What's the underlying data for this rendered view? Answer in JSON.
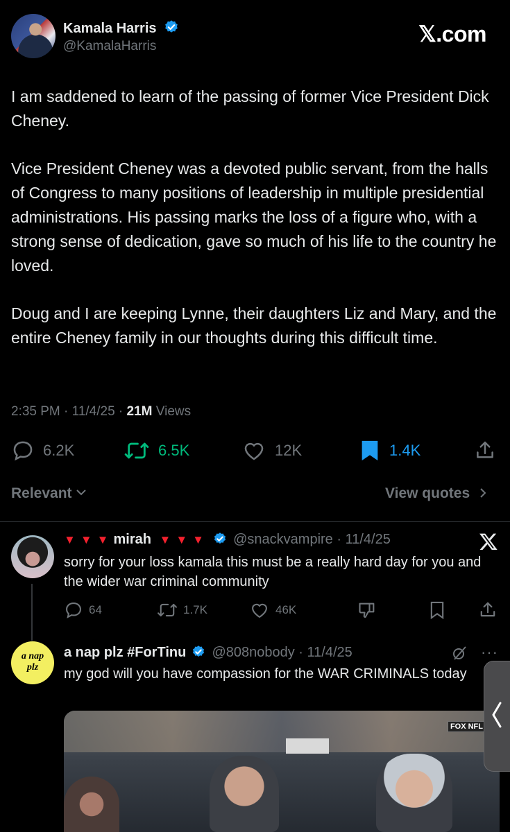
{
  "post": {
    "author_name": "Kamala Harris",
    "handle": "@KamalaHarris",
    "watermark": "𝕏.com",
    "paragraphs": [
      "I am saddened to learn of the passing of former Vice President Dick Cheney.",
      "Vice President Cheney was a devoted public servant, from the halls of Congress to many positions of leadership in multiple presidential administrations. His passing marks the loss of a figure who, with a strong sense of dedication, gave so much of his life to the country he loved.",
      "Doug and I are keeping Lynne, their daughters Liz and Mary, and the entire Cheney family in our thoughts during this difficult time."
    ],
    "time": "2:35 PM",
    "date": "11/4/25",
    "views_count": "21M",
    "views_label": "Views",
    "stats": {
      "replies": "6.2K",
      "reposts": "6.5K",
      "likes": "12K",
      "bookmarks": "1.4K"
    }
  },
  "filters": {
    "sort_label": "Relevant",
    "quotes_label": "View quotes"
  },
  "replies": [
    {
      "name": "mirah",
      "handle": "@snackvampire",
      "date": "11/4/25",
      "text": "sorry for your loss kamala this must be a really hard day for you and the wider war criminal community",
      "stats": {
        "replies": "64",
        "reposts": "1.7K",
        "likes": "46K"
      }
    },
    {
      "name": "a nap plz #ForTinu",
      "handle": "@808nobody",
      "date": "11/4/25",
      "text": "my god will you have compassion for the WAR CRIMINALS today",
      "avatar_text_line1": "a nap",
      "avatar_text_line2": "plz",
      "media_badge": "FOX NFL"
    }
  ],
  "colors": {
    "background": "#000000",
    "text": "#e7e9ea",
    "secondary": "#71767b",
    "verified": "#1d9bf0",
    "repost_active": "#00ba7c",
    "bookmark_active": "#1d9bf0",
    "red_triangle": "#f4212e"
  }
}
